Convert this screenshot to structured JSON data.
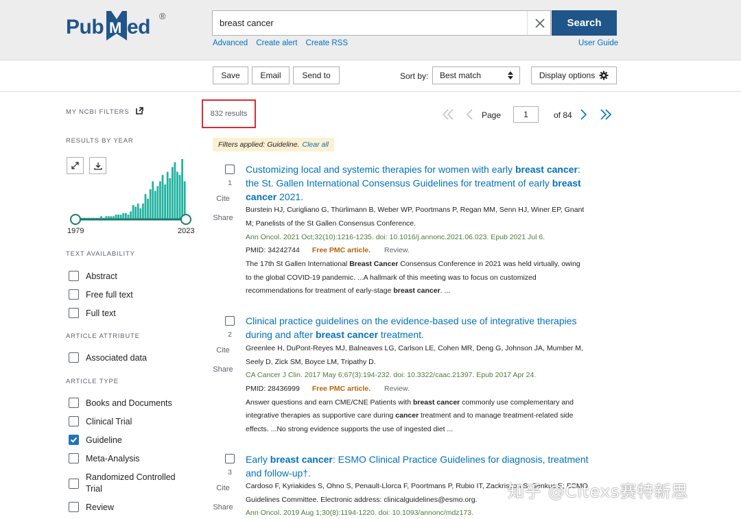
{
  "header": {
    "logo_text": "PubMed",
    "logo_reg": "®",
    "search_value": "breast cancer",
    "search_button": "Search",
    "links": [
      "Advanced",
      "Create alert",
      "Create RSS"
    ],
    "user_guide": "User Guide"
  },
  "toolbar": {
    "save": "Save",
    "email": "Email",
    "send_to": "Send to",
    "sort_label": "Sort by:",
    "sort_value": "Best match",
    "display_options": "Display options"
  },
  "sidebar": {
    "my_ncbi_filters": "MY NCBI FILTERS",
    "results_by_year": "RESULTS BY YEAR",
    "year_start": "1979",
    "year_end": "2023",
    "year_bars": [
      1,
      1,
      1,
      1,
      1,
      1,
      1,
      1,
      1,
      1,
      2,
      1,
      2,
      2,
      2,
      2,
      3,
      3,
      3,
      4,
      4,
      3,
      5,
      9,
      8,
      10,
      7,
      10,
      16,
      13,
      19,
      24,
      18,
      21,
      24,
      28,
      22,
      30,
      26,
      33,
      36,
      30,
      28,
      38,
      24
    ],
    "text_availability_title": "TEXT AVAILABILITY",
    "text_availability": [
      {
        "label": "Abstract",
        "checked": false
      },
      {
        "label": "Free full text",
        "checked": false
      },
      {
        "label": "Full text",
        "checked": false
      }
    ],
    "article_attribute_title": "ARTICLE ATTRIBUTE",
    "article_attribute": [
      {
        "label": "Associated data",
        "checked": false
      }
    ],
    "article_type_title": "ARTICLE TYPE",
    "article_type": [
      {
        "label": "Books and Documents",
        "checked": false
      },
      {
        "label": "Clinical Trial",
        "checked": false
      },
      {
        "label": "Guideline",
        "checked": true
      },
      {
        "label": "Meta-Analysis",
        "checked": false
      },
      {
        "label": "Randomized Controlled Trial",
        "checked": false
      },
      {
        "label": "Review",
        "checked": false
      }
    ]
  },
  "results_header": {
    "count": "832 results",
    "page_label": "Page",
    "page_value": "1",
    "of_pages": "of 84",
    "filters_applied": "Filters applied: Guideline.",
    "clear_all": "Clear all"
  },
  "results": [
    {
      "num": "1",
      "cite": "Cite",
      "share": "Share",
      "title_line1_a": "Customizing local and systemic therapies for women with early ",
      "title_line1_b": "breast cancer",
      "title_line1_c": ":",
      "title_line2_a": "the St. Gallen International Consensus Guidelines for treatment of early ",
      "title_line2_b": "breast",
      "title_line3_a": "cancer",
      "title_line3_b": " 2021.",
      "authors1": "Burstein HJ, Curigliano G, Thürlimann B, Weber WP, Poortmans P, Regan MM, Senn HJ, Winer EP, Gnant",
      "authors2": "M; Panelists of the St Gallen Consensus Conference.",
      "citation": "Ann Oncol. 2021 Oct;32(10):1216-1235. doi: 10.1016/j.annonc.2021.06.023. Epub 2021 Jul 6.",
      "pmid": "PMID: 34242744",
      "free_pmc": "Free PMC article.",
      "review": "Review.",
      "snippet1_a": "The 17th St Gallen International ",
      "snippet1_b": "Breast Cancer",
      "snippet1_c": " Consensus Conference in 2021 was held virtually, owing",
      "snippet2": "to the global COVID-19 pandemic. ...A hallmark of this meeting was to focus on customized",
      "snippet3_a": "recommendations for treatment of early-stage ",
      "snippet3_b": "breast cancer",
      "snippet3_c": ". ..."
    },
    {
      "num": "2",
      "cite": "Cite",
      "share": "Share",
      "title_line1": "Clinical practice guidelines on the evidence-based use of integrative therapies",
      "title_line2_a": "during and after ",
      "title_line2_b": "breast cancer",
      "title_line2_c": " treatment.",
      "authors1": "Greenlee H, DuPont-Reyes MJ, Balneaves LG, Carlson LE, Cohen MR, Deng G, Johnson JA, Mumber M,",
      "authors2": "Seely D, Zick SM, Boyce LM, Tripathy D.",
      "citation": "CA Cancer J Clin. 2017 May 6;67(3):194-232. doi: 10.3322/caac.21397. Epub 2017 Apr 24.",
      "pmid": "PMID: 28436999",
      "free_pmc": "Free PMC article.",
      "review": "Review.",
      "snippet1_a": "Answer questions and earn CME/CNE Patients with ",
      "snippet1_b": "breast cancer",
      "snippet1_c": " commonly use complementary and",
      "snippet2_a": "integrative therapies as supportive care during ",
      "snippet2_b": "cancer",
      "snippet2_c": " treatment and to manage treatment-related side",
      "snippet3": "effects. ...No strong evidence supports the use of ingested diet ..."
    },
    {
      "num": "3",
      "cite": "Cite",
      "share": "Share",
      "title_line1_a": "Early ",
      "title_line1_b": "breast cancer",
      "title_line1_c": ": ESMO Clinical Practice Guidelines for diagnosis, treatment",
      "title_line2": "and follow-up†.",
      "authors1": "Cardoso F, Kyriakides S, Ohno S, Penault-Llorca F, Poortmans P, Rubio IT, Zackrisson S, Senkus E; ESMO",
      "authors2": "Guidelines Committee. Electronic address: clinicalguidelines@esmo.org.",
      "citation": "Ann Oncol. 2019 Aug 1;30(8):1194-1220. doi: 10.1093/annonc/mdz173."
    }
  ],
  "watermark": "知乎 @Citexs赛特新思",
  "colors": {
    "brand": "#20558a",
    "link": "#0071bc",
    "chart_bar": "#20b2a0",
    "filter_bg": "#fbf1d2",
    "highlight_box": "#d32f2f",
    "free_pmc": "#b8620a"
  }
}
